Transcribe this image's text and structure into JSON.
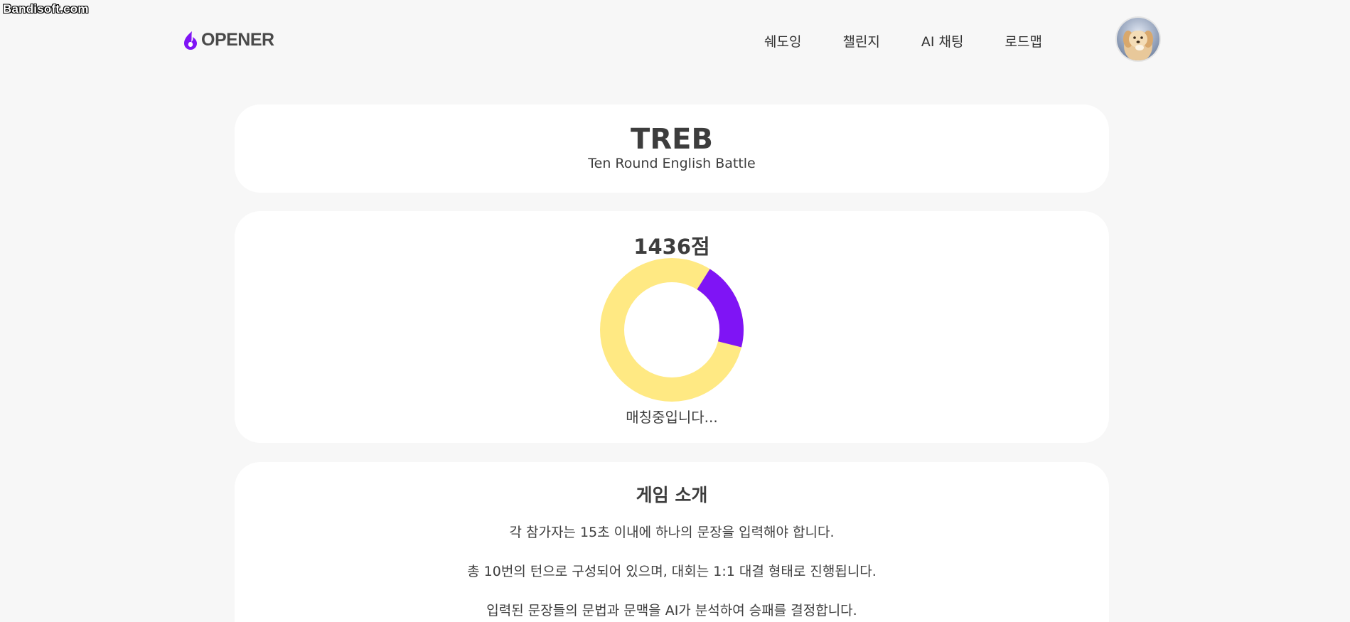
{
  "watermark": "Bandisoft.com",
  "header": {
    "logo_text": "OPENER",
    "nav": [
      "쉐도잉",
      "챌린지",
      "AI 채팅",
      "로드맵"
    ]
  },
  "title_card": {
    "title": "TREB",
    "subtitle": "Ten Round English Battle"
  },
  "score_card": {
    "score": "1436점",
    "status": "매칭중입니다...",
    "progress_fraction": 0.2,
    "colors": {
      "track": "#ffe983",
      "progress": "#7f14f5"
    }
  },
  "intro_card": {
    "title": "게임 소개",
    "lines": [
      "각 참가자는 15초 이내에 하나의 문장을 입력해야 합니다.",
      "총 10번의 턴으로 구성되어 있으며, 대회는 1:1 대결 형태로 진행됩니다.",
      "입력된 문장들의 문법과 문맥을 AI가 분석하여 승패를 결정합니다."
    ]
  },
  "colors": {
    "accent": "#7f14f5",
    "background": "#f7f7f7"
  }
}
